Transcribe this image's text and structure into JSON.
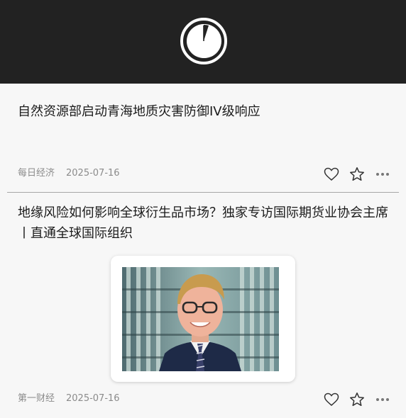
{
  "articles": [
    {
      "title": "自然资源部启动青海地质灾害防御IV级响应",
      "source": "每日经济",
      "date": "2025-07-16",
      "icons": {
        "like": "heart-outline-icon",
        "favorite": "star-outline-icon",
        "more": "more-dots-icon"
      }
    },
    {
      "title": "地缘风险如何影响全球衍生品市场？独家专访国际期货业协会主席丨直通全球国际组织",
      "source": "第一财经",
      "date": "2025-07-16",
      "icons": {
        "like": "heart-outline-icon",
        "favorite": "star-outline-icon",
        "more": "more-dots-icon"
      }
    }
  ],
  "colors": {
    "header": "#222222",
    "background": "#f7f7f7",
    "text": "#1b1b1b",
    "meta": "#8b8b8b"
  }
}
